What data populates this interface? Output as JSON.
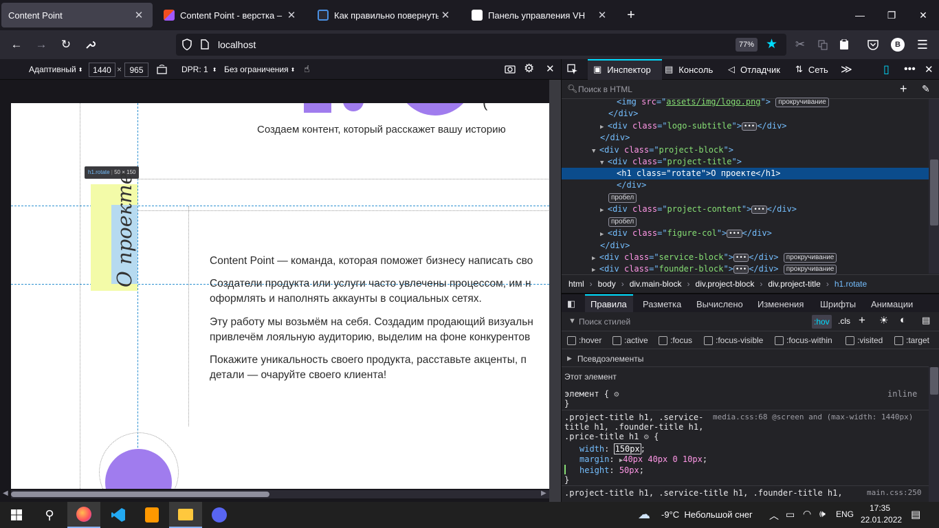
{
  "tabs": [
    {
      "title": "Content Point",
      "favicon_color": "#42414d",
      "active": true
    },
    {
      "title": "Content Point - верстка – Figm",
      "favicon_color": "#f24e1e",
      "active": false
    },
    {
      "title": "Как правильно повернуть текс",
      "favicon_color": "#f48024",
      "active": false
    },
    {
      "title": "Панель управления VH",
      "favicon_color": "#ffffff",
      "active": false
    }
  ],
  "window_controls": {
    "new_tab": "+",
    "minimize": "—",
    "maximize": "❐",
    "close": "✕"
  },
  "nav": {
    "url": "localhost",
    "zoom": "77%",
    "avatar_letter": "B"
  },
  "rdm": {
    "device": "Адаптивный",
    "width": "1440",
    "times": "×",
    "height": "965",
    "dpr": "DPR: 1",
    "throttle": "Без ограничения"
  },
  "page": {
    "tagline": "Создаем контент, который расскажет вашу историю",
    "rotated_title": "О проекте",
    "tooltip_selector": "h1.rotate",
    "tooltip_size": "50 × 150",
    "paragraphs": [
      [
        "Content Point — команда, которая поможет бизнесу написать сво"
      ],
      [
        "Создатели продукта или услуги часто увлечены процессом, им н",
        "оформлять и наполнять аккаунты в социальных сетях."
      ],
      [
        "Эту работу мы возьмём на себя. Создадим продающий визуальн",
        "привлечём лояльную аудиторию, выделим на фоне конкурентов"
      ],
      [
        "Покажите уникальность своего продукта, расставьте акценты, п",
        "детали — очаруйте своего клиента!"
      ]
    ]
  },
  "devtools": {
    "tabs": [
      "Инспектор",
      "Консоль",
      "Отладчик",
      "Сеть"
    ],
    "search_placeholder": "Поиск в HTML",
    "breadcrumbs": [
      "html",
      "body",
      "div.main-block",
      "div.project-block",
      "div.project-title",
      "h1.rotate"
    ],
    "subtabs": [
      "Правила",
      "Разметка",
      "Вычислено",
      "Изменения",
      "Шрифты",
      "Анимации"
    ],
    "filter_placeholder": "Поиск стилей",
    "hov": ":hov",
    "cls": ".cls",
    "pseudo": [
      ":hover",
      ":active",
      ":focus",
      ":focus-visible",
      ":focus-within",
      ":visited",
      ":target"
    ],
    "pseudo_elements": "Псевдоэлементы",
    "this_element": "Этот элемент",
    "element_rule": "элемент {",
    "inline": "inline",
    "rule1_selector": [
      ".project-title h1, .service-",
      "title h1, .founder-title h1,",
      ".price-title h1"
    ],
    "rule1_source": "media.css:68 @screen and (max-width: 1440px)",
    "rule1_props": [
      {
        "name": "width",
        "value": "150px"
      },
      {
        "name": "margin",
        "value": "40px 40px 0 10px"
      },
      {
        "name": "height",
        "value": "50px"
      }
    ],
    "rule2_selector": ".project-title h1, .service-title h1, .founder-title h1,",
    "rule2_source": "main.css:250"
  },
  "taskbar": {
    "weather": "-9°C  Небольшой снег",
    "lang": "ENG",
    "time": "17:35",
    "date": "22.01.2022"
  }
}
